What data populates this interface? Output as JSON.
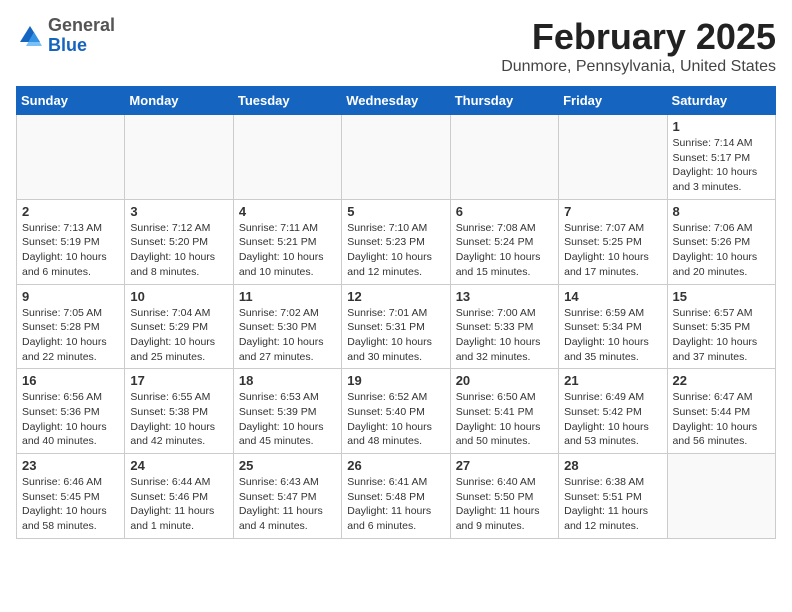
{
  "header": {
    "logo_line1": "General",
    "logo_line2": "Blue",
    "month_year": "February 2025",
    "location": "Dunmore, Pennsylvania, United States"
  },
  "days_of_week": [
    "Sunday",
    "Monday",
    "Tuesday",
    "Wednesday",
    "Thursday",
    "Friday",
    "Saturday"
  ],
  "weeks": [
    [
      {
        "day": "",
        "info": ""
      },
      {
        "day": "",
        "info": ""
      },
      {
        "day": "",
        "info": ""
      },
      {
        "day": "",
        "info": ""
      },
      {
        "day": "",
        "info": ""
      },
      {
        "day": "",
        "info": ""
      },
      {
        "day": "1",
        "info": "Sunrise: 7:14 AM\nSunset: 5:17 PM\nDaylight: 10 hours\nand 3 minutes."
      }
    ],
    [
      {
        "day": "2",
        "info": "Sunrise: 7:13 AM\nSunset: 5:19 PM\nDaylight: 10 hours\nand 6 minutes."
      },
      {
        "day": "3",
        "info": "Sunrise: 7:12 AM\nSunset: 5:20 PM\nDaylight: 10 hours\nand 8 minutes."
      },
      {
        "day": "4",
        "info": "Sunrise: 7:11 AM\nSunset: 5:21 PM\nDaylight: 10 hours\nand 10 minutes."
      },
      {
        "day": "5",
        "info": "Sunrise: 7:10 AM\nSunset: 5:23 PM\nDaylight: 10 hours\nand 12 minutes."
      },
      {
        "day": "6",
        "info": "Sunrise: 7:08 AM\nSunset: 5:24 PM\nDaylight: 10 hours\nand 15 minutes."
      },
      {
        "day": "7",
        "info": "Sunrise: 7:07 AM\nSunset: 5:25 PM\nDaylight: 10 hours\nand 17 minutes."
      },
      {
        "day": "8",
        "info": "Sunrise: 7:06 AM\nSunset: 5:26 PM\nDaylight: 10 hours\nand 20 minutes."
      }
    ],
    [
      {
        "day": "9",
        "info": "Sunrise: 7:05 AM\nSunset: 5:28 PM\nDaylight: 10 hours\nand 22 minutes."
      },
      {
        "day": "10",
        "info": "Sunrise: 7:04 AM\nSunset: 5:29 PM\nDaylight: 10 hours\nand 25 minutes."
      },
      {
        "day": "11",
        "info": "Sunrise: 7:02 AM\nSunset: 5:30 PM\nDaylight: 10 hours\nand 27 minutes."
      },
      {
        "day": "12",
        "info": "Sunrise: 7:01 AM\nSunset: 5:31 PM\nDaylight: 10 hours\nand 30 minutes."
      },
      {
        "day": "13",
        "info": "Sunrise: 7:00 AM\nSunset: 5:33 PM\nDaylight: 10 hours\nand 32 minutes."
      },
      {
        "day": "14",
        "info": "Sunrise: 6:59 AM\nSunset: 5:34 PM\nDaylight: 10 hours\nand 35 minutes."
      },
      {
        "day": "15",
        "info": "Sunrise: 6:57 AM\nSunset: 5:35 PM\nDaylight: 10 hours\nand 37 minutes."
      }
    ],
    [
      {
        "day": "16",
        "info": "Sunrise: 6:56 AM\nSunset: 5:36 PM\nDaylight: 10 hours\nand 40 minutes."
      },
      {
        "day": "17",
        "info": "Sunrise: 6:55 AM\nSunset: 5:38 PM\nDaylight: 10 hours\nand 42 minutes."
      },
      {
        "day": "18",
        "info": "Sunrise: 6:53 AM\nSunset: 5:39 PM\nDaylight: 10 hours\nand 45 minutes."
      },
      {
        "day": "19",
        "info": "Sunrise: 6:52 AM\nSunset: 5:40 PM\nDaylight: 10 hours\nand 48 minutes."
      },
      {
        "day": "20",
        "info": "Sunrise: 6:50 AM\nSunset: 5:41 PM\nDaylight: 10 hours\nand 50 minutes."
      },
      {
        "day": "21",
        "info": "Sunrise: 6:49 AM\nSunset: 5:42 PM\nDaylight: 10 hours\nand 53 minutes."
      },
      {
        "day": "22",
        "info": "Sunrise: 6:47 AM\nSunset: 5:44 PM\nDaylight: 10 hours\nand 56 minutes."
      }
    ],
    [
      {
        "day": "23",
        "info": "Sunrise: 6:46 AM\nSunset: 5:45 PM\nDaylight: 10 hours\nand 58 minutes."
      },
      {
        "day": "24",
        "info": "Sunrise: 6:44 AM\nSunset: 5:46 PM\nDaylight: 11 hours\nand 1 minute."
      },
      {
        "day": "25",
        "info": "Sunrise: 6:43 AM\nSunset: 5:47 PM\nDaylight: 11 hours\nand 4 minutes."
      },
      {
        "day": "26",
        "info": "Sunrise: 6:41 AM\nSunset: 5:48 PM\nDaylight: 11 hours\nand 6 minutes."
      },
      {
        "day": "27",
        "info": "Sunrise: 6:40 AM\nSunset: 5:50 PM\nDaylight: 11 hours\nand 9 minutes."
      },
      {
        "day": "28",
        "info": "Sunrise: 6:38 AM\nSunset: 5:51 PM\nDaylight: 11 hours\nand 12 minutes."
      },
      {
        "day": "",
        "info": ""
      }
    ]
  ]
}
